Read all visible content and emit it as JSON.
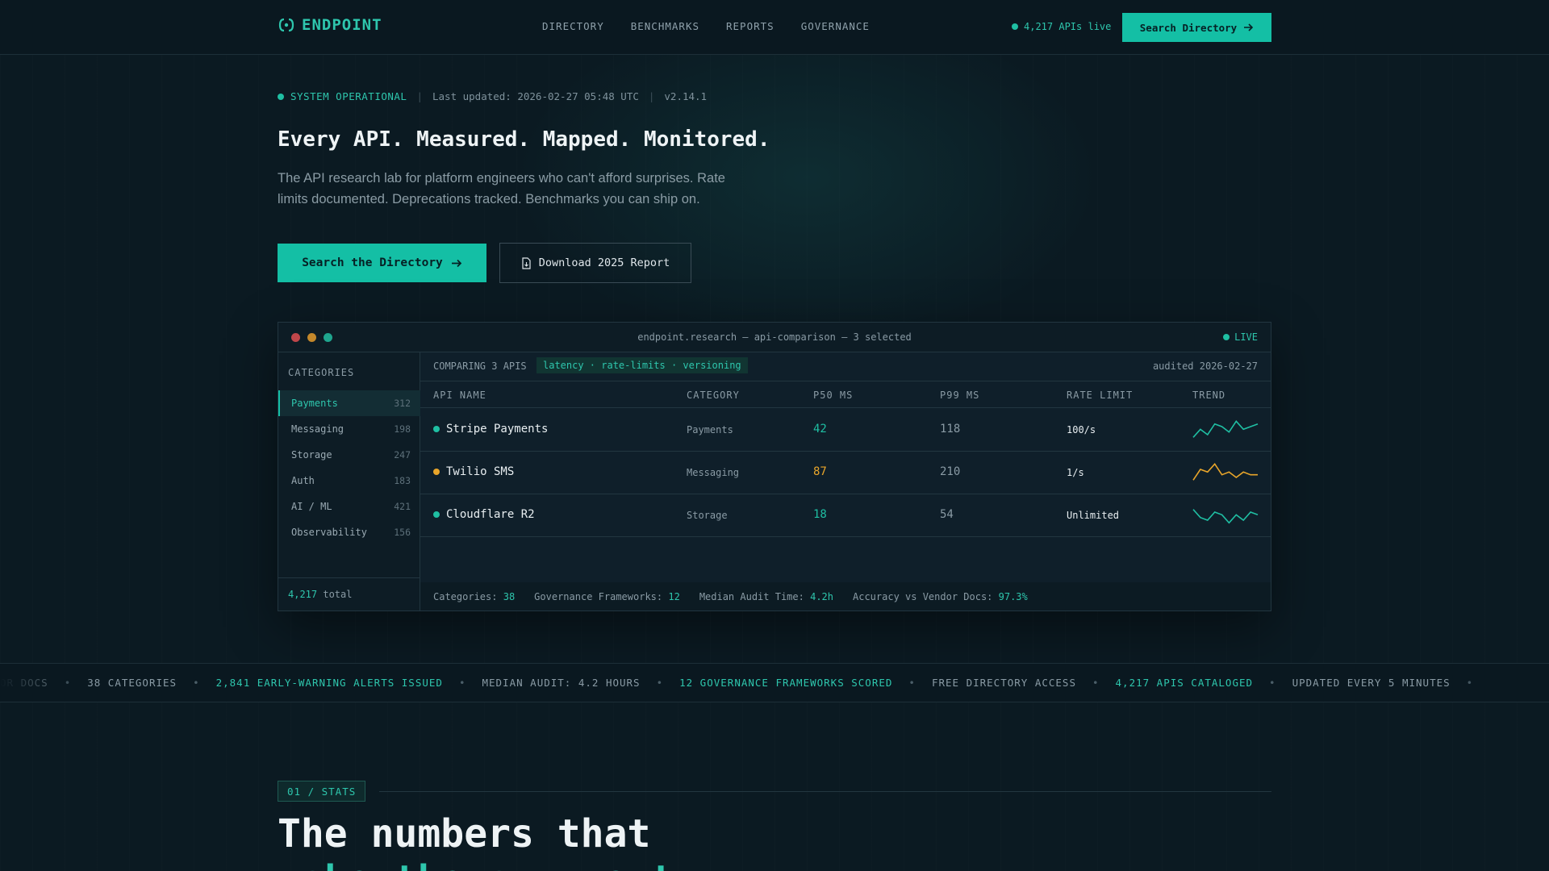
{
  "brand": {
    "name": "ENDPOINT",
    "logo_icon": "bracket-logo-icon"
  },
  "nav": {
    "links": [
      "DIRECTORY",
      "BENCHMARKS",
      "REPORTS",
      "GOVERNANCE"
    ],
    "live_count": "4,217 APIs live",
    "cta": "Search Directory",
    "cta_icon": "arrow-right-icon"
  },
  "status": {
    "state": "SYSTEM OPERATIONAL",
    "updated": "Last updated: 2026-02-27 05:48 UTC",
    "version": "v2.14.1",
    "separator": "|"
  },
  "hero": {
    "title": "Every API. Measured. Mapped. Monitored.",
    "subtitle": "The API research lab for platform engineers who can't afford surprises. Rate limits documented. Deprecations tracked. Benchmarks you can ship on.",
    "primary_cta": "Search the Directory",
    "secondary_cta": "Download 2025 Report",
    "secondary_icon": "document-icon"
  },
  "window": {
    "title": "endpoint.research — api-comparison — 3 selected",
    "live": "LIVE",
    "lights": [
      "#c0464a",
      "#c4882b",
      "#1fa58e"
    ],
    "sidebar": {
      "heading": "CATEGORIES",
      "items": [
        {
          "label": "Payments",
          "count": "312",
          "active": true
        },
        {
          "label": "Messaging",
          "count": "198",
          "active": false
        },
        {
          "label": "Storage",
          "count": "247",
          "active": false
        },
        {
          "label": "Auth",
          "count": "183",
          "active": false
        },
        {
          "label": "AI / ML",
          "count": "421",
          "active": false
        },
        {
          "label": "Observability",
          "count": "156",
          "active": false
        }
      ],
      "total_value": "4,217",
      "total_label": "total"
    },
    "compare": {
      "label": "COMPARING 3 APIS",
      "tags": "latency · rate-limits · versioning",
      "audited": "audited 2026-02-27"
    },
    "columns": [
      "API NAME",
      "CATEGORY",
      "P50 MS",
      "P99 MS",
      "RATE LIMIT",
      "TREND"
    ],
    "rows": [
      {
        "name": "Stripe Payments",
        "category": "Payments",
        "p50": "42",
        "p99": "118",
        "rate": "100/s",
        "color": "#1fbfa3",
        "trend": [
          2,
          5,
          3,
          7,
          6,
          4,
          8,
          5,
          6,
          7
        ]
      },
      {
        "name": "Twilio SMS",
        "category": "Messaging",
        "p50": "87",
        "p99": "210",
        "rate": "1/s",
        "color": "#e8a52a",
        "trend": [
          2,
          6,
          5,
          8,
          4,
          5,
          3,
          5,
          4,
          4
        ]
      },
      {
        "name": "Cloudflare R2",
        "category": "Storage",
        "p50": "18",
        "p99": "54",
        "rate": "Unlimited",
        "color": "#1fbfa3",
        "trend": [
          7,
          4,
          3,
          6,
          5,
          2,
          5,
          3,
          6,
          5
        ]
      }
    ],
    "stats": [
      {
        "label": "Categories:",
        "value": "38"
      },
      {
        "label": "Governance Frameworks:",
        "value": "12"
      },
      {
        "label": "Median Audit Time:",
        "value": "4.2h"
      },
      {
        "label": "Accuracy vs Vendor Docs:",
        "value": "97.3%"
      }
    ]
  },
  "ticker": [
    {
      "text": "OR DOCS",
      "hi": false
    },
    {
      "text": "38 CATEGORIES",
      "hi": false
    },
    {
      "text": "2,841 EARLY-WARNING ALERTS ISSUED",
      "hi": true
    },
    {
      "text": "MEDIAN AUDIT: 4.2 HOURS",
      "hi": false
    },
    {
      "text": "12 GOVERNANCE FRAMEWORKS SCORED",
      "hi": true
    },
    {
      "text": "FREE DIRECTORY ACCESS",
      "hi": false
    },
    {
      "text": "4,217 APIS CATALOGED",
      "hi": true
    },
    {
      "text": "UPDATED EVERY 5 MINUTES",
      "hi": false
    }
  ],
  "section": {
    "tag": "01 / STATS",
    "title_line1": "The numbers that",
    "title_line2": "make the argument"
  }
}
